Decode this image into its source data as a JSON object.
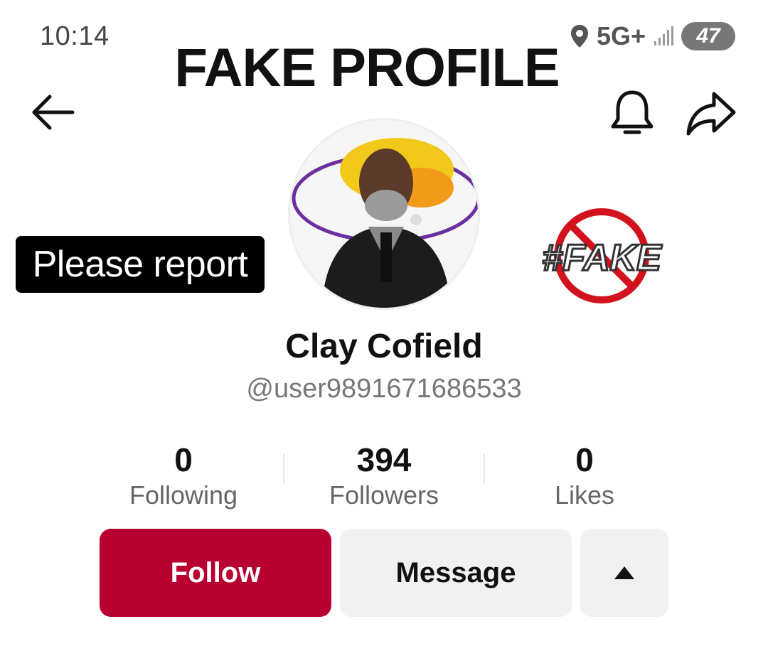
{
  "status_bar": {
    "time": "10:14",
    "network": "5G+",
    "battery": "47",
    "icons": [
      "location-icon",
      "signal-icon",
      "battery-icon"
    ]
  },
  "overlay": {
    "title": "FAKE PROFILE",
    "report_label": "Please report",
    "badge_text": "#FAKE"
  },
  "nav": {
    "back_icon": "arrow-left-icon",
    "bell_icon": "bell-icon",
    "share_icon": "share-icon"
  },
  "profile": {
    "display_name": "Clay Cofield",
    "username": "@user9891671686533"
  },
  "stats": [
    {
      "value": "0",
      "label": "Following"
    },
    {
      "value": "394",
      "label": "Followers"
    },
    {
      "value": "0",
      "label": "Likes"
    }
  ],
  "actions": {
    "follow_label": "Follow",
    "message_label": "Message",
    "more_icon": "triangle-up-icon"
  },
  "colors": {
    "follow_button": "#b70030",
    "secondary_button": "#f1f1f2",
    "badge_red": "#d2121c"
  }
}
